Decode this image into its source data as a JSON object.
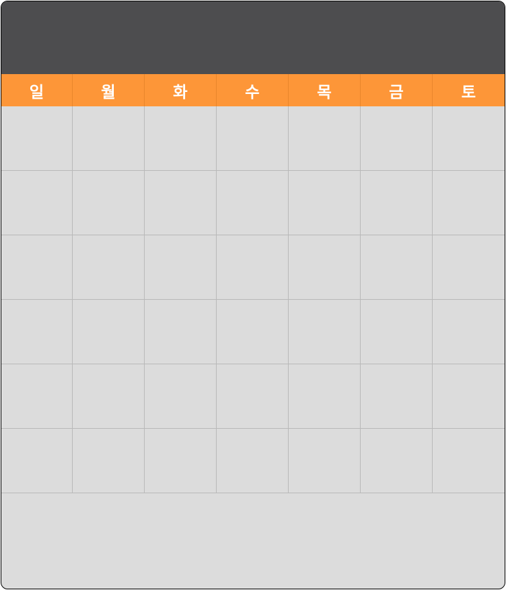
{
  "calendar": {
    "header": {
      "title": ""
    },
    "weekdays": [
      "일",
      "월",
      "화",
      "수",
      "목",
      "금",
      "토"
    ],
    "weeks": [
      [
        "",
        "",
        "",
        "",
        "",
        "",
        ""
      ],
      [
        "",
        "",
        "",
        "",
        "",
        "",
        ""
      ],
      [
        "",
        "",
        "",
        "",
        "",
        "",
        ""
      ],
      [
        "",
        "",
        "",
        "",
        "",
        "",
        ""
      ],
      [
        "",
        "",
        "",
        "",
        "",
        "",
        ""
      ],
      [
        "",
        "",
        "",
        "",
        "",
        "",
        ""
      ]
    ]
  },
  "colors": {
    "header_bg": "#4d4d4f",
    "weekday_bg": "#fd9638",
    "weekday_text": "#ffffff",
    "grid_bg": "#dcdcdc",
    "grid_line": "#b9b9b9",
    "border": "#000000"
  }
}
